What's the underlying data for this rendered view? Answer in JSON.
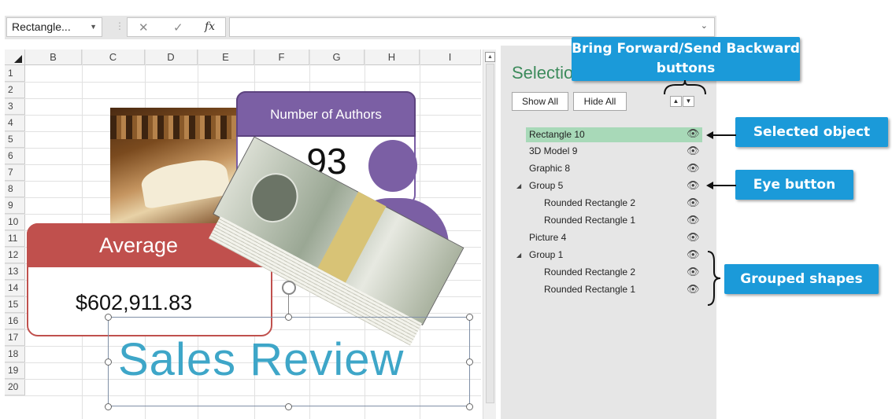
{
  "formula_bar": {
    "name_box": "Rectangle...",
    "cancel_icon": "✕",
    "enter_icon": "✓",
    "fx_icon": "fx",
    "value": ""
  },
  "sheet": {
    "columns": [
      "B",
      "C",
      "D",
      "E",
      "F",
      "G",
      "H",
      "I"
    ],
    "rows": [
      "1",
      "2",
      "3",
      "4",
      "5",
      "6",
      "7",
      "8",
      "9",
      "10",
      "11",
      "12",
      "13",
      "14",
      "15",
      "16",
      "17",
      "18",
      "19",
      "20"
    ]
  },
  "shapes": {
    "authors_header": "Number of Authors",
    "authors_value": "93",
    "average_header": "Average",
    "average_value": "$602,911.83",
    "title_text": "Sales Review"
  },
  "selection_pane": {
    "title": "Selection",
    "show_all": "Show All",
    "hide_all": "Hide All",
    "items": [
      {
        "label": "Rectangle 10"
      },
      {
        "label": "3D Model 9"
      },
      {
        "label": "Graphic 8"
      },
      {
        "label": "Group 5"
      },
      {
        "label": "Rounded Rectangle 2"
      },
      {
        "label": "Rounded Rectangle 1"
      },
      {
        "label": "Picture 4"
      },
      {
        "label": "Group 1"
      },
      {
        "label": "Rounded Rectangle 2"
      },
      {
        "label": "Rounded Rectangle 1"
      }
    ]
  },
  "callouts": {
    "bring_forward": "Bring Forward/Send Backward buttons",
    "selected_object": "Selected object",
    "eye_button": "Eye button",
    "grouped_shapes": "Grouped shapes"
  },
  "colors": {
    "callout_blue": "#1b9ad9",
    "selected_green": "#a8d9b8",
    "purple": "#7b5fa4",
    "red": "#c0504d"
  }
}
